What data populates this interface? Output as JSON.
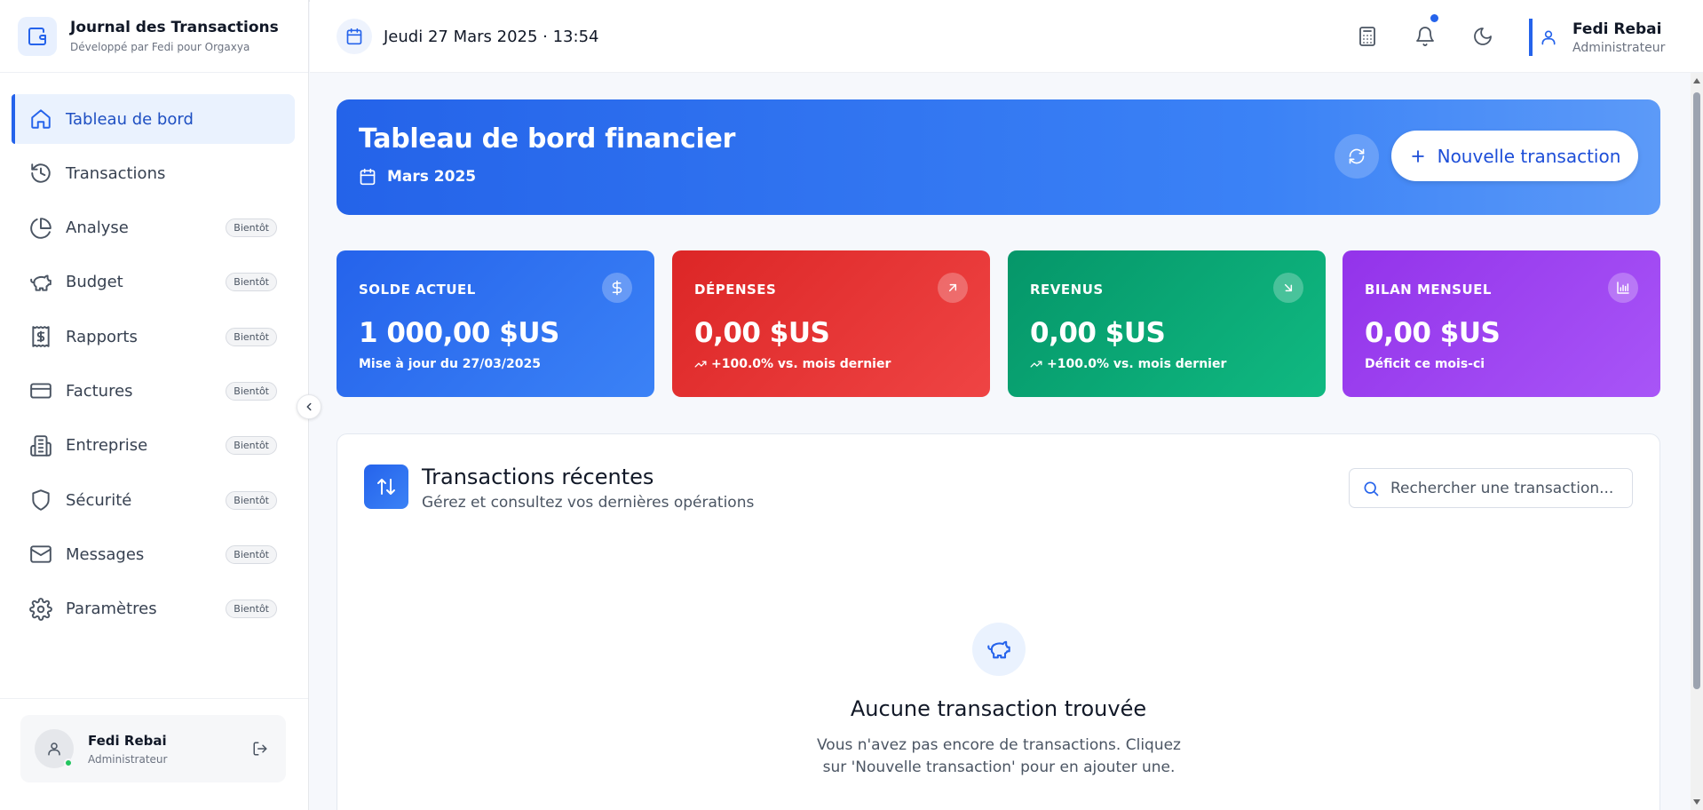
{
  "brand": {
    "title": "Journal des Transactions",
    "subtitle": "Développé par Fedi pour Orgaxya",
    "icon": "wallet-icon"
  },
  "sidebar": {
    "items": [
      {
        "label": "Tableau de bord",
        "icon": "home-icon",
        "active": true,
        "badge": ""
      },
      {
        "label": "Transactions",
        "icon": "history-icon",
        "badge": ""
      },
      {
        "label": "Analyse",
        "icon": "pie-chart-icon",
        "badge": "Bientôt"
      },
      {
        "label": "Budget",
        "icon": "piggy-bank-icon",
        "badge": "Bientôt"
      },
      {
        "label": "Rapports",
        "icon": "receipt-dollar-icon",
        "badge": "Bientôt"
      },
      {
        "label": "Factures",
        "icon": "credit-card-icon",
        "badge": "Bientôt"
      },
      {
        "label": "Entreprise",
        "icon": "building-icon",
        "badge": "Bientôt"
      },
      {
        "label": "Sécurité",
        "icon": "shield-icon",
        "badge": "Bientôt"
      },
      {
        "label": "Messages",
        "icon": "mail-icon",
        "badge": "Bientôt"
      },
      {
        "label": "Paramètres",
        "icon": "gear-icon",
        "badge": "Bientôt"
      }
    ],
    "user": {
      "name": "Fedi Rebai",
      "role": "Administrateur"
    }
  },
  "topbar": {
    "datetime": "Jeudi 27 Mars 2025 · 13:54",
    "user": {
      "name": "Fedi Rebai",
      "role": "Administrateur"
    }
  },
  "hero": {
    "title": "Tableau de bord financier",
    "month": "Mars 2025",
    "new_button": "Nouvelle transaction"
  },
  "stats": [
    {
      "label": "SOLDE ACTUEL",
      "value": "1 000,00 $US",
      "note": "Mise à jour du 27/03/2025",
      "icon": "dollar-icon",
      "color": "#2563eb"
    },
    {
      "label": "DÉPENSES",
      "value": "0,00 $US",
      "note": "+100.0% vs. mois dernier",
      "icon": "arrow-up-right-icon",
      "color": "#dc2626"
    },
    {
      "label": "REVENUS",
      "value": "0,00 $US",
      "note": "+100.0% vs. mois dernier",
      "icon": "arrow-down-right-icon",
      "color": "#059669"
    },
    {
      "label": "BILAN MENSUEL",
      "value": "0,00 $US",
      "note": "Déficit ce mois-ci",
      "icon": "bar-chart-icon",
      "color": "#9333ea"
    }
  ],
  "transactions": {
    "title": "Transactions récentes",
    "subtitle": "Gérez et consultez vos dernières opérations",
    "search_placeholder": "Rechercher une transaction...",
    "empty_title": "Aucune transaction trouvée",
    "empty_text": "Vous n'avez pas encore de transactions. Cliquez sur 'Nouvelle transaction' pour en ajouter une."
  }
}
